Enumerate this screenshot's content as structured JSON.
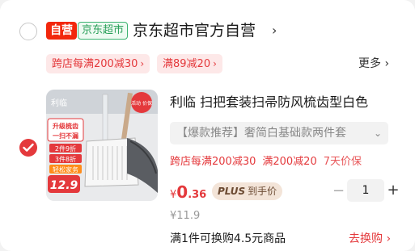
{
  "store": {
    "tag_self": "自营",
    "tag_channel": "京东超市",
    "name": "京东超市官方自营",
    "chevron": "›"
  },
  "promos": [
    {
      "label": "跨店每满200减30",
      "chevron": "›"
    },
    {
      "label": "满89减20",
      "chevron": "›"
    }
  ],
  "more": {
    "label": "更多",
    "chevron": "›"
  },
  "item": {
    "selected": true,
    "thumb": {
      "brand": "利临",
      "corner": "活动 价保",
      "lines": [
        "升级梳齿",
        "一扫不漏"
      ],
      "offers": [
        "2件9折",
        "3件8折",
        "轻松家务"
      ],
      "price": "12.9"
    },
    "title": "利临 扫把套装扫帚防风梳齿型白色",
    "variant": "【爆款推荐】奢简白基础款两件套",
    "variant_chevron": "⌄",
    "promo_a": "跨店每满200减30",
    "promo_b": "满200减20",
    "promo_c": "7天价保",
    "price_currency": "¥",
    "price_int": "0",
    "price_dec": ".36",
    "plus_mark": "PLUS",
    "plus_label": "到手价",
    "qty": "1",
    "minus": "−",
    "plus": "+",
    "orig_price": "¥11.9",
    "exchange_text": "满1件可换购4.5元商品",
    "exchange_link": "去换购 ›"
  },
  "colors": {
    "accent": "#e4393c",
    "promo_bg": "#fde8e8",
    "channel_green": "#2aa05a",
    "plus_bg": "#f3e4d8"
  }
}
